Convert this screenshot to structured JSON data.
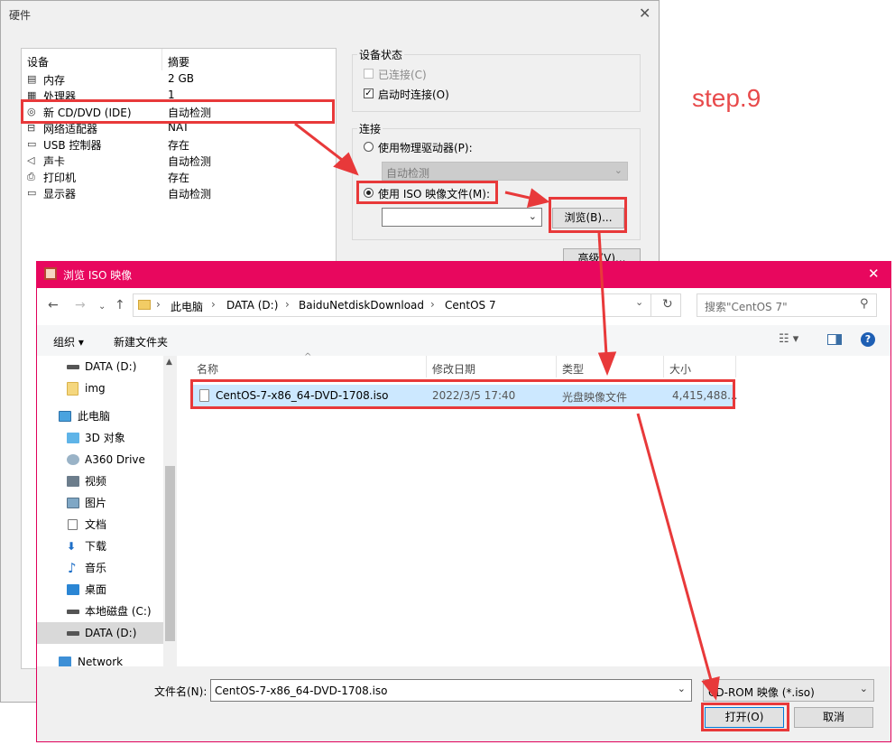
{
  "hardware_dialog": {
    "title": "硬件",
    "close": "✕",
    "device_list": {
      "headers": {
        "device": "设备",
        "summary": "摘要"
      },
      "items": [
        {
          "name": "内存",
          "summary": "2 GB",
          "icon": "memory-icon"
        },
        {
          "name": "处理器",
          "summary": "1",
          "icon": "processor-icon"
        },
        {
          "name": "新 CD/DVD (IDE)",
          "summary": "自动检测",
          "icon": "cd-dvd-icon",
          "selected": true
        },
        {
          "name": "网络适配器",
          "summary": "NAT",
          "icon": "network-adapter-icon"
        },
        {
          "name": "USB 控制器",
          "summary": "存在",
          "icon": "usb-icon"
        },
        {
          "name": "声卡",
          "summary": "自动检测",
          "icon": "sound-card-icon"
        },
        {
          "name": "打印机",
          "summary": "存在",
          "icon": "printer-icon"
        },
        {
          "name": "显示器",
          "summary": "自动检测",
          "icon": "display-icon"
        }
      ]
    },
    "device_status": {
      "title": "设备状态",
      "connected": {
        "label": "已连接(C)",
        "checked": false,
        "disabled": true
      },
      "connect_at_power_on": {
        "label": "启动时连接(O)",
        "checked": true
      }
    },
    "connection": {
      "title": "连接",
      "physical_drive": {
        "label": "使用物理驱动器(P):",
        "selected": false
      },
      "physical_drive_value": "自动检测",
      "iso_image": {
        "label": "使用 ISO 映像文件(M):",
        "selected": true
      },
      "iso_path": "",
      "browse_button": "浏览(B)...",
      "advanced_button": "高级(V)..."
    }
  },
  "annotation": {
    "step_label": "step.9",
    "highlight_color": "#e8393a"
  },
  "browse_dialog": {
    "title": "浏览 ISO 映像",
    "close": "✕",
    "breadcrumb": [
      "此电脑",
      "DATA (D:)",
      "BaiduNetdiskDownload",
      "CentOS 7"
    ],
    "search_placeholder": "搜索\"CentOS 7\"",
    "toolbar": {
      "organize": "组织 ▾",
      "new_folder": "新建文件夹"
    },
    "nav_items": [
      {
        "label": "DATA (D:)",
        "icon": "drive-icon",
        "level": 2
      },
      {
        "label": "img",
        "icon": "folder-icon",
        "level": 2
      },
      {
        "label": "此电脑",
        "icon": "computer-icon",
        "level": 1
      },
      {
        "label": "3D 对象",
        "icon": "3d-objects-icon",
        "level": 2
      },
      {
        "label": "A360 Drive",
        "icon": "a360-icon",
        "level": 2
      },
      {
        "label": "视频",
        "icon": "videos-icon",
        "level": 2
      },
      {
        "label": "图片",
        "icon": "pictures-icon",
        "level": 2
      },
      {
        "label": "文档",
        "icon": "documents-icon",
        "level": 2
      },
      {
        "label": "下载",
        "icon": "downloads-icon",
        "level": 2
      },
      {
        "label": "音乐",
        "icon": "music-icon",
        "level": 2
      },
      {
        "label": "桌面",
        "icon": "desktop-icon",
        "level": 2
      },
      {
        "label": "本地磁盘 (C:)",
        "icon": "drive-icon",
        "level": 2
      },
      {
        "label": "DATA (D:)",
        "icon": "drive-icon",
        "level": 2,
        "selected": true
      },
      {
        "label": "Network",
        "icon": "network-icon",
        "level": 1
      }
    ],
    "columns": [
      "名称",
      "修改日期",
      "类型",
      "大小"
    ],
    "files": [
      {
        "name": "CentOS-7-x86_64-DVD-1708.iso",
        "date": "2022/3/5 17:40",
        "type": "光盘映像文件",
        "size": "4,415,488..."
      }
    ],
    "filename_label": "文件名(N):",
    "filename_value": "CentOS-7-x86_64-DVD-1708.iso",
    "filetype_value": "CD-ROM 映像 (*.iso)",
    "open_button": "打开(O)",
    "cancel_button": "取消"
  }
}
